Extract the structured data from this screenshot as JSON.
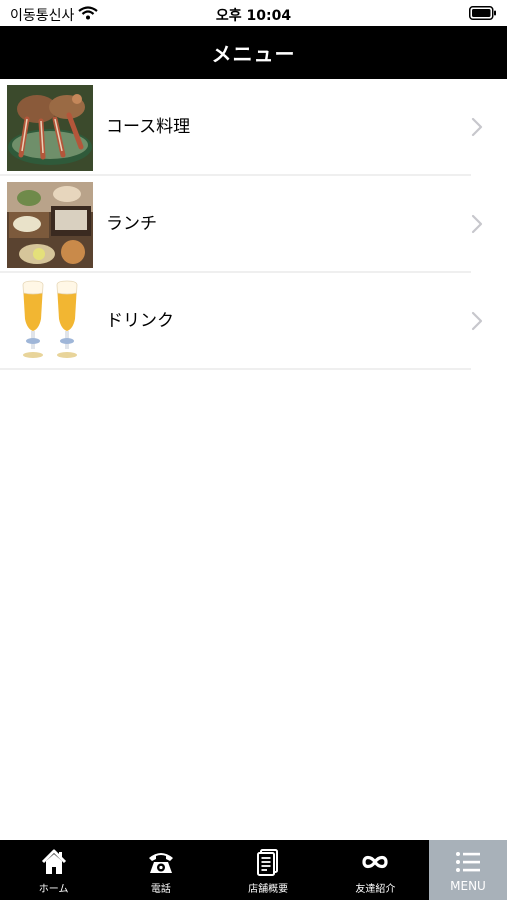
{
  "status_bar": {
    "carrier": "이동통신사",
    "time": "오후 10:04"
  },
  "nav": {
    "title": "メニュー"
  },
  "menu": {
    "items": [
      {
        "label": "コース料理",
        "image": "crab-dish-photo"
      },
      {
        "label": "ランチ",
        "image": "lunch-set-photo"
      },
      {
        "label": "ドリンク",
        "image": "beer-glasses-photo"
      }
    ]
  },
  "tabbar": {
    "tabs": [
      {
        "label": "ホーム",
        "icon": "home-icon"
      },
      {
        "label": "電話",
        "icon": "phone-icon"
      },
      {
        "label": "店舗概要",
        "icon": "document-icon"
      },
      {
        "label": "友達紹介",
        "icon": "infinity-icon"
      },
      {
        "label": "MENU",
        "icon": "list-icon",
        "active": true
      }
    ]
  },
  "colors": {
    "nav_bg": "#000000",
    "tab_active_bg": "#a8b1b9",
    "divider": "#efefef"
  }
}
